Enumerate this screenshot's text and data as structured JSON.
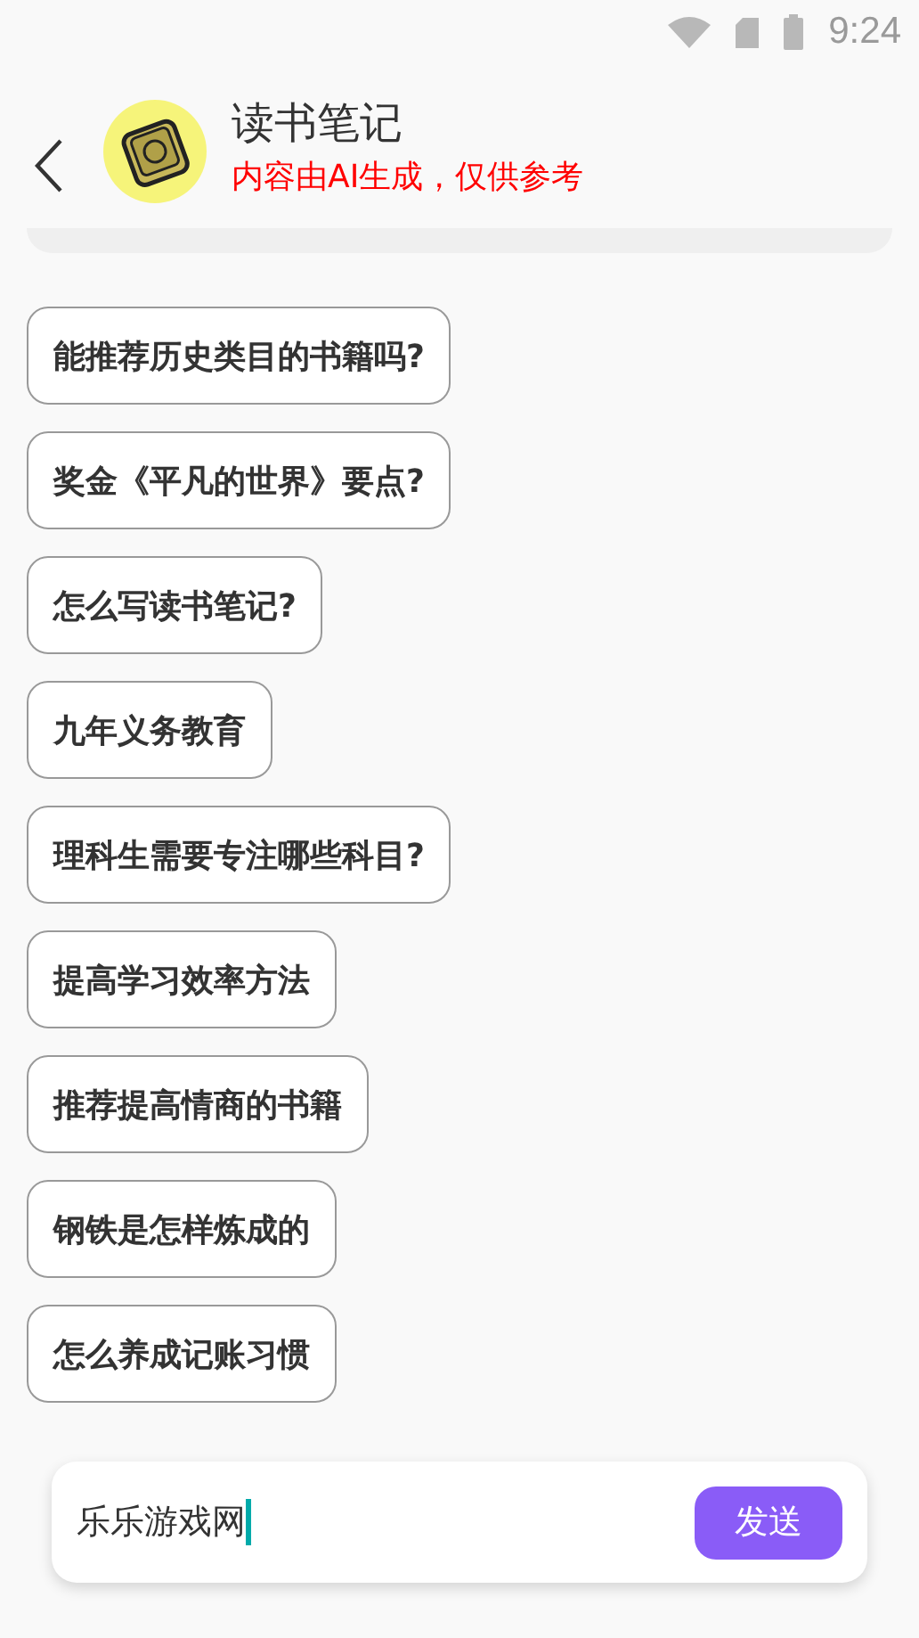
{
  "status_bar": {
    "time": "9:24"
  },
  "header": {
    "title": "读书笔记",
    "subtitle": "内容由AI生成，仅供参考"
  },
  "suggestions": [
    "能推荐历史类目的书籍吗?",
    "奖金《平凡的世界》要点?",
    "怎么写读书笔记?",
    "九年义务教育",
    "理科生需要专注哪些科目?",
    "提高学习效率方法",
    "推荐提高情商的书籍",
    "钢铁是怎样炼成的",
    "怎么养成记账习惯"
  ],
  "input": {
    "value": "乐乐游戏网",
    "send_label": "发送"
  }
}
